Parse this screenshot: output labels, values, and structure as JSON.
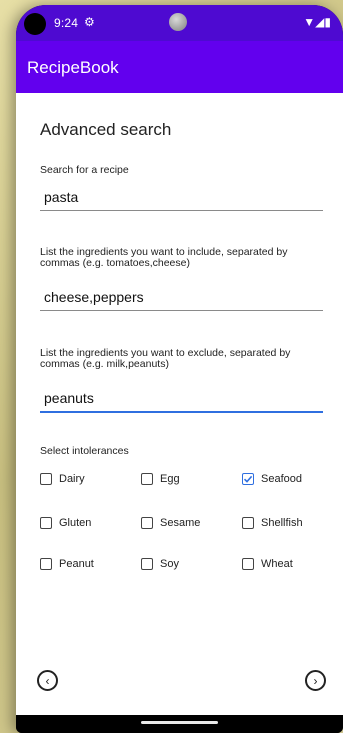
{
  "status_bar": {
    "time": "9:24",
    "settings_icon": "gear-icon",
    "signal": "▼◢▮"
  },
  "app_bar": {
    "title": "RecipeBook"
  },
  "main": {
    "heading": "Advanced search",
    "search_label": "Search for a recipe",
    "search_value": "pasta",
    "include_label": "List the ingredients you want to include, separated by commas (e.g. tomatoes,cheese)",
    "include_value": "cheese,peppers",
    "exclude_label": "List the ingredients you want to exclude, separated by commas (e.g. milk,peanuts)",
    "exclude_value": "peanuts",
    "intolerances_label": "Select intolerances",
    "intolerances": [
      {
        "label": "Dairy",
        "checked": false
      },
      {
        "label": "Egg",
        "checked": false
      },
      {
        "label": "Seafood",
        "checked": true
      },
      {
        "label": "Gluten",
        "checked": false
      },
      {
        "label": "Sesame",
        "checked": false
      },
      {
        "label": "Shellfish",
        "checked": false
      },
      {
        "label": "Peanut",
        "checked": false
      },
      {
        "label": "Soy",
        "checked": false
      },
      {
        "label": "Wheat",
        "checked": false
      }
    ],
    "prev_icon": "chevron-left-circle-icon",
    "next_icon": "chevron-right-circle-icon"
  },
  "colors": {
    "status": "#4e0ad1",
    "appbar": "#6200ee",
    "accent": "#2f6fe0"
  }
}
